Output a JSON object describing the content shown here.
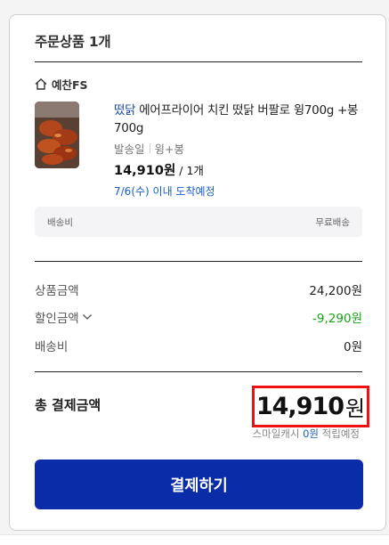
{
  "order": {
    "header": "주문상품 1개",
    "seller_name": "예찬FS",
    "product": {
      "brand": "떴닭",
      "name_rest": " 에어프라이어 치킨 떴닭 버팔로 윙700g +봉700g",
      "ship_type": "발송일",
      "option": "윙+봉",
      "price": "14,910원",
      "qty": "/ 1개",
      "eta": "7/6(수) 이내 도착예정"
    },
    "shipping_box": {
      "label": "배송비",
      "value": "무료배송"
    }
  },
  "summary": {
    "rows": [
      {
        "label": "상품금액",
        "value": "24,200원"
      },
      {
        "label": "할인금액",
        "value": "-9,290원"
      },
      {
        "label": "배송비",
        "value": "0원"
      }
    ],
    "total_label": "총 결제금액",
    "total_amount": "14,910",
    "total_unit": "원",
    "points_prefix": "스마일캐시 ",
    "points_value": "0원",
    "points_suffix": " 적립예정",
    "pay_button": "결제하기"
  },
  "colors": {
    "pay_button": "#0a2ca8",
    "discount": "#17a317",
    "link_blue": "#1a5fc8",
    "highlight_border": "#ee1111"
  },
  "icons": [
    "home-icon",
    "chevron-down-icon"
  ]
}
